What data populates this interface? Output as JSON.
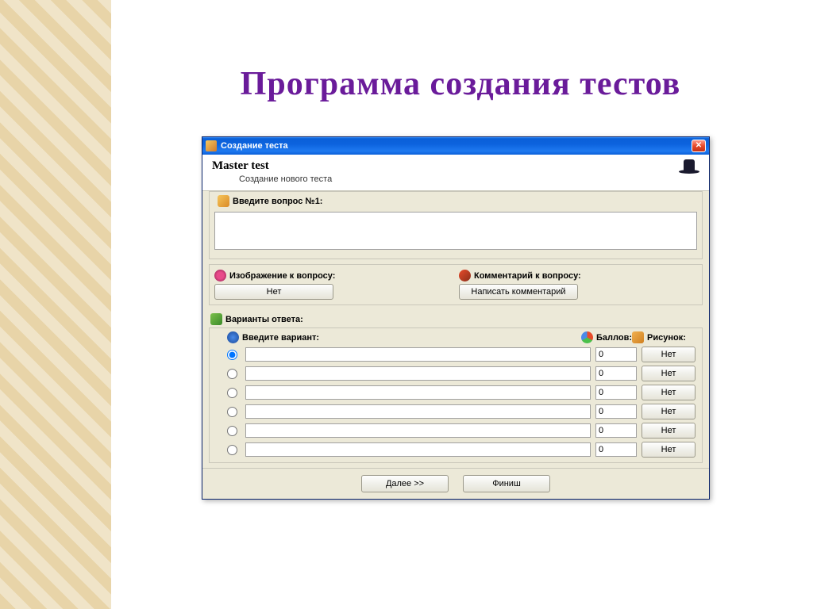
{
  "page_heading": "Программа создания тестов",
  "titlebar": {
    "title": "Создание теста",
    "close": "✕"
  },
  "header": {
    "title": "Master test",
    "subtitle": "Создание нового теста"
  },
  "question": {
    "prompt_label": "Введите вопрос №1:",
    "value": "",
    "image_label": "Изображение к вопросу:",
    "image_button": "Нет",
    "comment_label": "Комментарий к вопросу:",
    "comment_button": "Написать комментарий"
  },
  "answers": {
    "section_label": "Варианты ответа:",
    "variant_header": "Введите вариант:",
    "score_header": "Баллов:",
    "image_header": "Рисунок:",
    "rows": [
      {
        "selected": true,
        "variant": "",
        "score": "0",
        "image_btn": "Нет"
      },
      {
        "selected": false,
        "variant": "",
        "score": "0",
        "image_btn": "Нет"
      },
      {
        "selected": false,
        "variant": "",
        "score": "0",
        "image_btn": "Нет"
      },
      {
        "selected": false,
        "variant": "",
        "score": "0",
        "image_btn": "Нет"
      },
      {
        "selected": false,
        "variant": "",
        "score": "0",
        "image_btn": "Нет"
      },
      {
        "selected": false,
        "variant": "",
        "score": "0",
        "image_btn": "Нет"
      }
    ]
  },
  "footer": {
    "next": "Далее >>",
    "finish": "Финиш"
  }
}
